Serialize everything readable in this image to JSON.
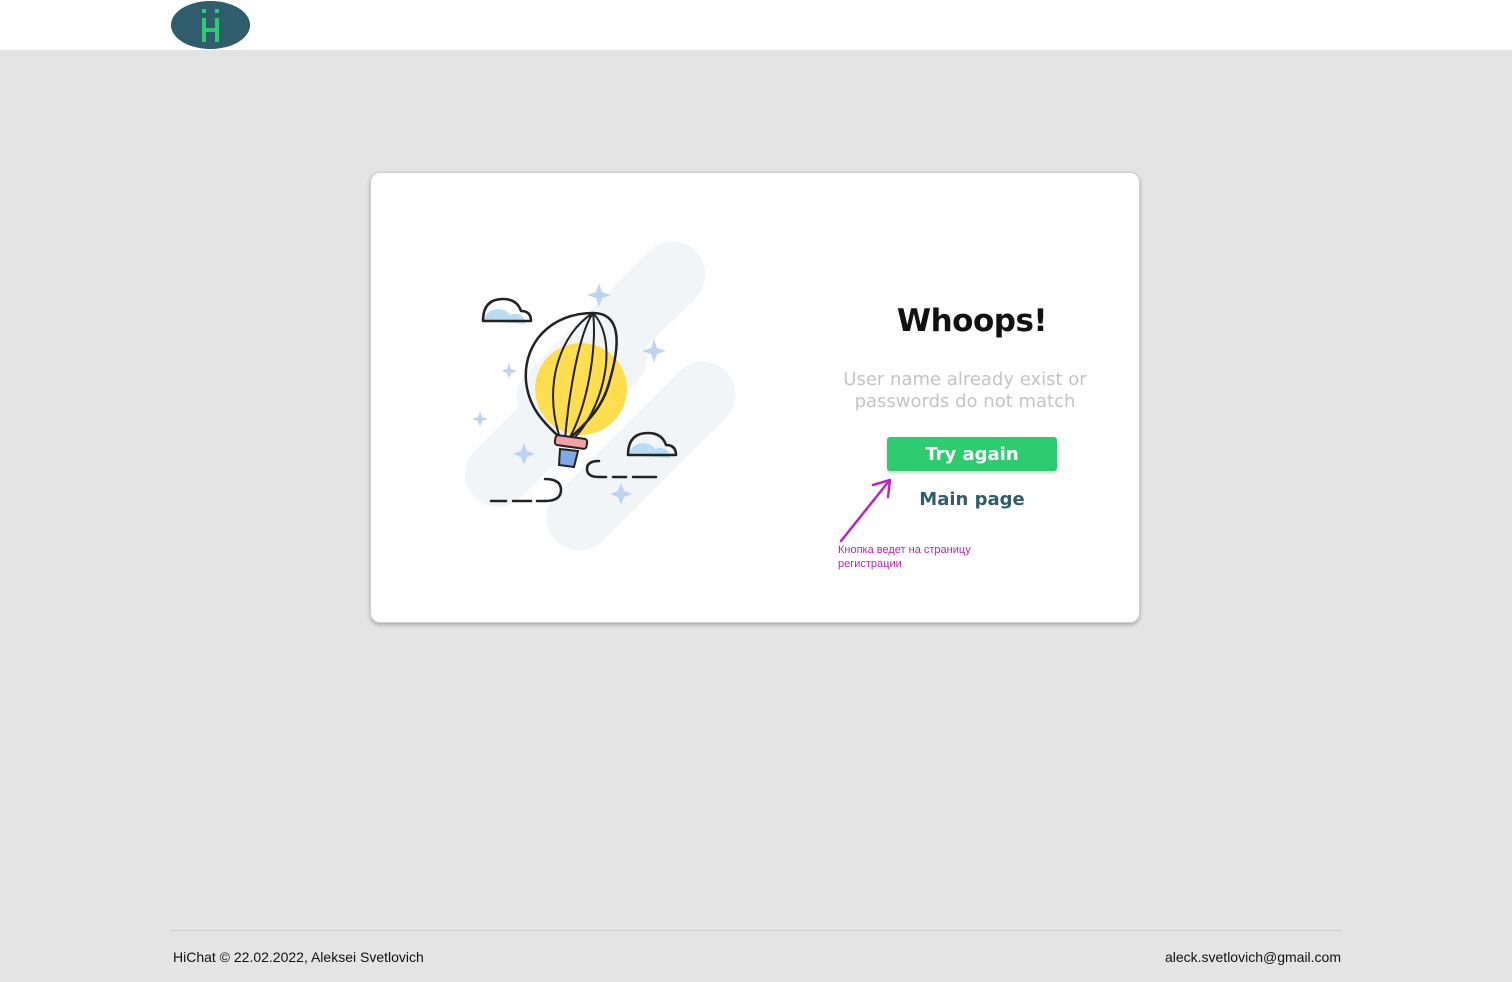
{
  "header": {
    "logo_text": "Hi"
  },
  "card": {
    "title": "Whoops!",
    "message": "User name already exist or passwords do not match",
    "try_again_label": "Try again",
    "main_page_label": "Main page",
    "annotation": "Кнопка ведет на страницу регистрации"
  },
  "footer": {
    "copyright": "HiChat © 22.02.2022, Aleksei Svetlovich",
    "email": "aleck.svetlovich@gmail.com"
  },
  "colors": {
    "logo_bg": "#2f5d6c",
    "logo_letter": "#2ecc71",
    "button_bg": "#2ecc71",
    "link": "#2f5d6c",
    "annotation": "#c020c0",
    "balloon": "#fede4f",
    "cloud": "#b9dcf5"
  },
  "icons": {
    "logo": "hi-logo-icon",
    "illustration": "hot-air-balloon-illustration"
  }
}
